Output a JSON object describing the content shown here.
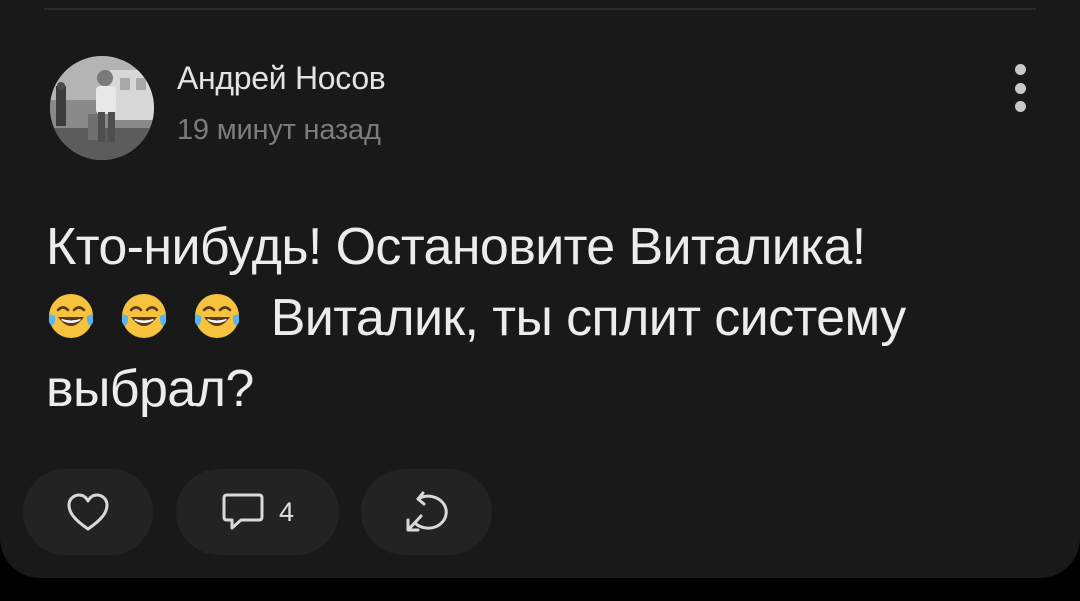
{
  "post": {
    "author_name": "Андрей Носов",
    "time": "19 минут назад",
    "text_line1": "Кто-нибудь! Остановите Виталика!",
    "text_line2": "Виталик, ты сплит систему выбрал?",
    "emojis": [
      "face-with-tears-of-joy",
      "face-with-tears-of-joy",
      "face-with-tears-of-joy"
    ]
  },
  "actions": {
    "comments_count": "4"
  },
  "icons": {
    "like": "heart-outline-icon",
    "comment": "speech-bubble-icon",
    "share": "share-arrow-icon",
    "more": "vertical-dots-icon"
  },
  "colors": {
    "background": "#000000",
    "card": "#191919",
    "button": "#232323",
    "text_primary": "#ececec",
    "text_secondary": "#7c7c7c"
  }
}
